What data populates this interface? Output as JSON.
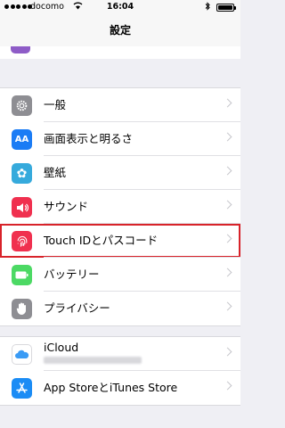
{
  "status_bar": {
    "carrier": "docomo",
    "time": "16:04",
    "wifi_icon": "wifi-icon",
    "bluetooth_icon": "bluetooth-icon",
    "battery_level": 1.0
  },
  "nav": {
    "title": "設定"
  },
  "sections": [
    {
      "items": [
        {
          "id": "general",
          "label": "一般",
          "icon": "gear-icon",
          "color": "#8e8e93",
          "glyph": "⚙"
        },
        {
          "id": "display",
          "label": "画面表示と明るさ",
          "icon": "text-size-icon",
          "color": "#1b7cf5",
          "glyph": "AA"
        },
        {
          "id": "wallpaper",
          "label": "壁紙",
          "icon": "flower-icon",
          "color": "#36aadc",
          "glyph": "✿"
        },
        {
          "id": "sounds",
          "label": "サウンド",
          "icon": "speaker-icon",
          "color": "#f0304f",
          "glyph": "🔊"
        },
        {
          "id": "touchid",
          "label": "Touch IDとパスコード",
          "icon": "fingerprint-icon",
          "color": "#f0304f",
          "glyph": "◎"
        },
        {
          "id": "battery",
          "label": "バッテリー",
          "icon": "battery-icon",
          "color": "#4cd964",
          "glyph": "▭"
        },
        {
          "id": "privacy",
          "label": "プライバシー",
          "icon": "hand-icon",
          "color": "#8e8e93",
          "glyph": "✋"
        }
      ]
    },
    {
      "items": [
        {
          "id": "icloud",
          "label": "iCloud",
          "icon": "cloud-icon",
          "color": "#ffffff",
          "glyph": "☁"
        },
        {
          "id": "appstore",
          "label": "App StoreとiTunes Store",
          "icon": "app-store-icon",
          "color": "#1b8cf5",
          "glyph": "A"
        }
      ]
    }
  ]
}
